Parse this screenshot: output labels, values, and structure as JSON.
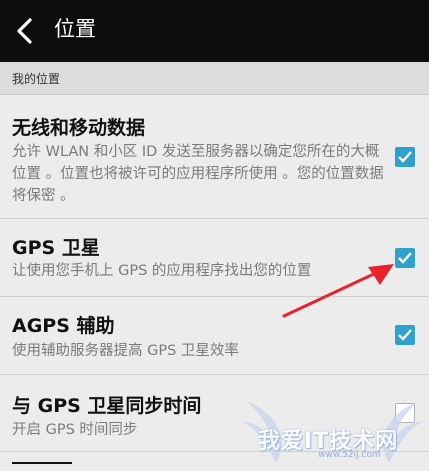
{
  "header": {
    "title": "位置"
  },
  "section": {
    "label": "我的位置"
  },
  "settings": [
    {
      "title": "无线和移动数据",
      "description": "允许 WLAN 和小区 ID 发送至服务器以确定您所在的大概位置 。位置也将被许可的应用程序所使用 。您的位置数据将保密 。",
      "checked": true
    },
    {
      "title": "GPS 卫星",
      "description": "让使用您手机上 GPS 的应用程序找出您的位置",
      "checked": true
    },
    {
      "title": "AGPS 辅助",
      "description": "使用辅助服务器提高 GPS 卫星效率",
      "checked": true
    },
    {
      "title": "与 GPS 卫星同步时间",
      "description": "开启 GPS 时间同步",
      "checked": false
    }
  ],
  "watermark": {
    "text": "我爱IT技术网",
    "url": "www.52ij.com"
  },
  "colors": {
    "accent": "#2fa1cc",
    "annotation_arrow": "#e8232b",
    "topbar": "#0d0d0d"
  }
}
